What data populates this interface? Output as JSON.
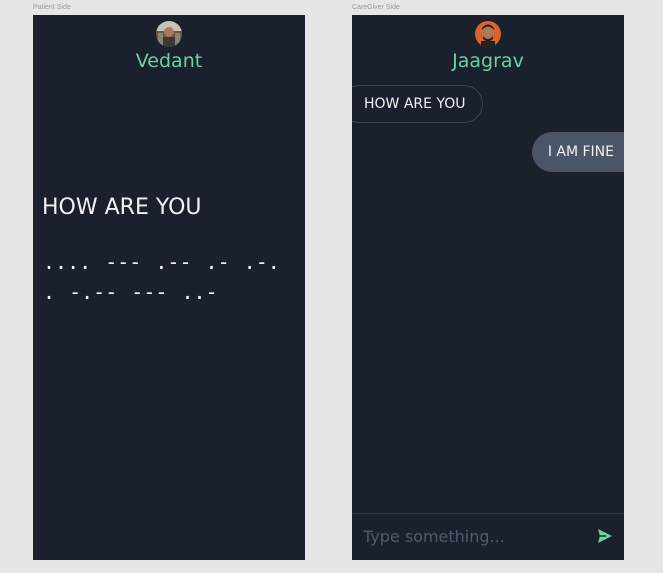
{
  "frames": {
    "patient": {
      "label": "Patient Side",
      "user_name": "Vedant",
      "message": "HOW ARE YOU",
      "morse": ".... --- .-- .- .-. . -.-- --- ..-"
    },
    "caregiver": {
      "label": "CareGiver Side",
      "user_name": "Jaagrav",
      "messages": [
        {
          "side": "received",
          "text": "HOW ARE YOU"
        },
        {
          "side": "sent",
          "text": "I AM FINE"
        }
      ],
      "input_placeholder": "Type something...",
      "input_value": ""
    }
  },
  "colors": {
    "background": "#e6e6e6",
    "panel": "#1a202c",
    "accent": "#68d3a1",
    "sent_bubble": "#4a5568",
    "received_border": "#3a4658"
  },
  "icons": {
    "send": "send-icon",
    "avatar_patient": "avatar-photo",
    "avatar_caregiver": "avatar-photo"
  }
}
